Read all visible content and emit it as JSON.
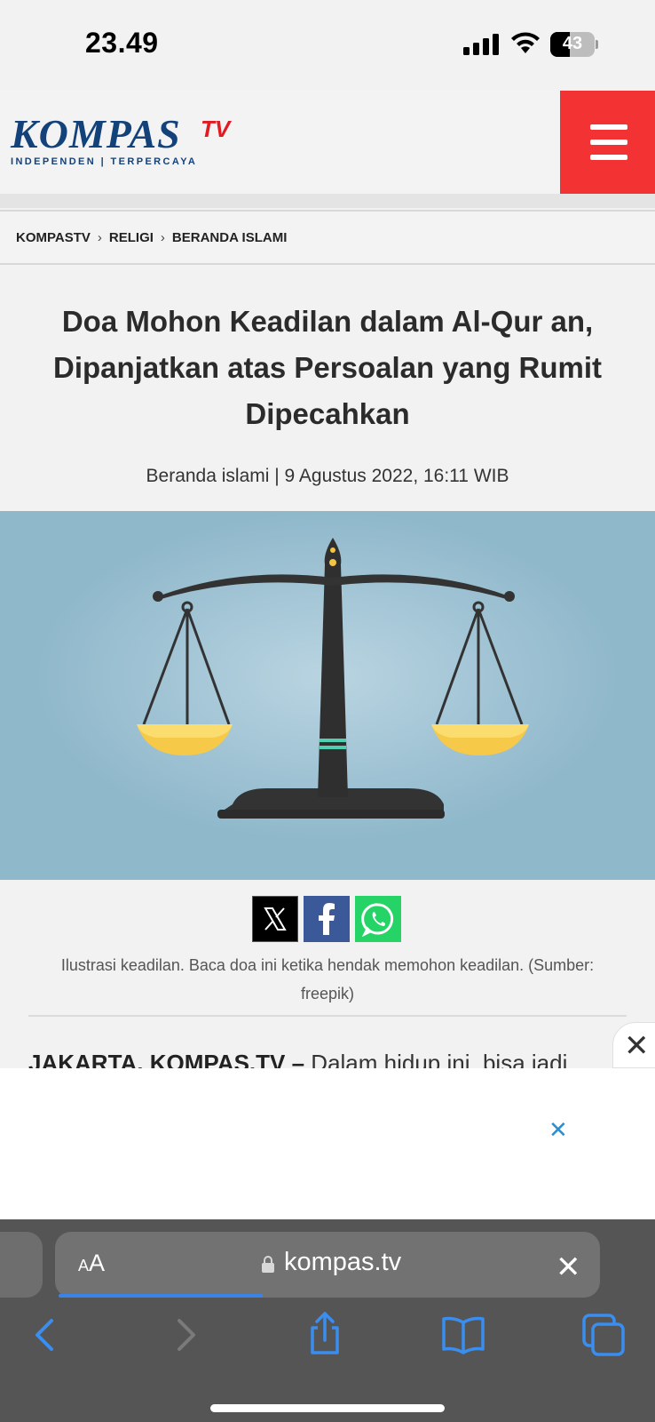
{
  "status_bar": {
    "time": "23.49",
    "battery": "43",
    "battery_level": 0.43
  },
  "header": {
    "logo_main": "KOMPAS",
    "logo_tv": "TV",
    "logo_tagline": "INDEPENDEN | TERPERCAYA"
  },
  "breadcrumb": [
    "KOMPASTV",
    "RELIGI",
    "BERANDA ISLAMI"
  ],
  "article": {
    "title": "Doa Mohon Keadilan dalam Al-Qur an, Dipanjatkan atas Persoalan yang Rumit Dipecahkan",
    "meta": "Beranda islami | 9 Agustus 2022, 16:11 WIB",
    "caption": "Ilustrasi keadilan. Baca doa ini ketika hendak memohon keadilan. (Sumber: freepik)",
    "lead_bold": "JAKARTA, KOMPAS.TV – ",
    "lead_text": "Dalam hidup ini, bisa jadi"
  },
  "share": {
    "x_icon": "x-logo-icon",
    "facebook_icon": "facebook-icon",
    "whatsapp_icon": "whatsapp-icon"
  },
  "browser": {
    "text_size_small": "A",
    "text_size_big": "A",
    "url": "kompas.tv",
    "load_progress": 0.38
  },
  "colors": {
    "brand_blue": "#13427a",
    "brand_red": "#e11b22",
    "menu_red": "#f33333",
    "hero_bg": "#8fb8cb"
  }
}
